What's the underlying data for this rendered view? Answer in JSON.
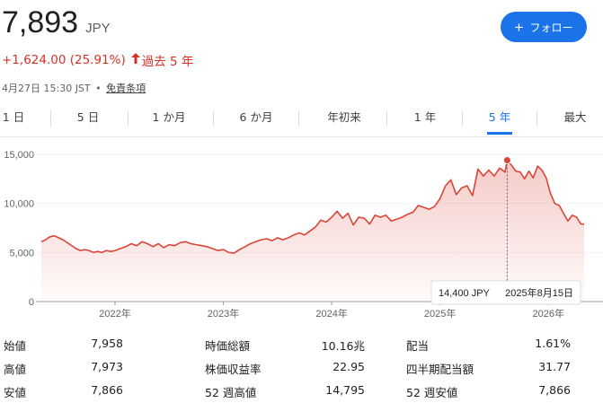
{
  "header": {
    "price": "7,893",
    "currency": "JPY",
    "change": "+1,624.00 (25.91%)",
    "change_period": "過去 5 年",
    "timestamp": "4月27日 15:30 JST",
    "separator": "•",
    "disclaimer": "免責条項",
    "follow_label": "フォロー",
    "follow_icon": "plus-icon",
    "accent_color": "#1a73e8",
    "negative_color": "#d93025"
  },
  "tabs": [
    {
      "label": "1 日",
      "active": false
    },
    {
      "label": "5 日",
      "active": false
    },
    {
      "label": "1 か月",
      "active": false
    },
    {
      "label": "6 か月",
      "active": false
    },
    {
      "label": "年初来",
      "active": false
    },
    {
      "label": "1 年",
      "active": false
    },
    {
      "label": "5 年",
      "active": true
    },
    {
      "label": "最大",
      "active": false
    }
  ],
  "chart_data": {
    "type": "area",
    "line_color": "#db4437",
    "y_ticks": [
      "15,000",
      "10,000",
      "5,000",
      "0"
    ],
    "y_tick_values": [
      15000,
      10000,
      5000,
      0
    ],
    "ylim": [
      0,
      15000
    ],
    "x_ticks": [
      "2022年",
      "2023年",
      "2024年",
      "2025年",
      "2026年"
    ],
    "x_tick_values": [
      2022.0,
      2023.0,
      2024.0,
      2025.0,
      2026.0
    ],
    "xlim": [
      2021.32,
      2026.33
    ],
    "grid": true,
    "tooltip": {
      "value": "14,400 JPY",
      "date": "2025年8月15日",
      "x": 2025.62,
      "y": 14400
    },
    "series": [
      {
        "x": [
          2021.32,
          2021.36,
          2021.4,
          2021.44,
          2021.48,
          2021.52,
          2021.56,
          2021.6,
          2021.64,
          2021.68,
          2021.72,
          2021.76,
          2021.8,
          2021.84,
          2021.88,
          2021.92,
          2021.96,
          2022.0,
          2022.05,
          2022.1,
          2022.15,
          2022.2,
          2022.25,
          2022.3,
          2022.35,
          2022.4,
          2022.45,
          2022.5,
          2022.55,
          2022.6,
          2022.65,
          2022.7,
          2022.75,
          2022.8,
          2022.85,
          2022.9,
          2022.95,
          2023.0,
          2023.05,
          2023.1,
          2023.15,
          2023.2,
          2023.25,
          2023.3,
          2023.35,
          2023.4,
          2023.45,
          2023.5,
          2023.55,
          2023.6,
          2023.65,
          2023.7,
          2023.75,
          2023.8,
          2023.85,
          2023.9,
          2023.95,
          2024.0,
          2024.05,
          2024.1,
          2024.15,
          2024.2,
          2024.25,
          2024.3,
          2024.35,
          2024.4,
          2024.45,
          2024.5,
          2024.55,
          2024.6,
          2024.65,
          2024.7,
          2024.75,
          2024.8,
          2024.85,
          2024.9,
          2024.95,
          2025.0,
          2025.05,
          2025.1,
          2025.15,
          2025.2,
          2025.25,
          2025.3,
          2025.35,
          2025.4,
          2025.45,
          2025.5,
          2025.55,
          2025.6,
          2025.62,
          2025.66,
          2025.7,
          2025.74,
          2025.78,
          2025.82,
          2025.86,
          2025.9,
          2025.94,
          2025.98,
          2026.02,
          2026.06,
          2026.1,
          2026.14,
          2026.18,
          2026.22,
          2026.26,
          2026.3,
          2026.33
        ],
        "y": [
          6100,
          6300,
          6600,
          6700,
          6500,
          6300,
          6000,
          5700,
          5400,
          5200,
          5300,
          5200,
          5000,
          5100,
          5000,
          5200,
          5100,
          5200,
          5400,
          5600,
          5900,
          5700,
          6100,
          5900,
          5600,
          5900,
          5500,
          5800,
          5700,
          6000,
          6100,
          5900,
          5800,
          5700,
          5600,
          5400,
          5200,
          5300,
          5000,
          4950,
          5300,
          5600,
          5900,
          6100,
          6300,
          6400,
          6200,
          6500,
          6300,
          6500,
          6800,
          7000,
          6800,
          7200,
          7600,
          8300,
          8100,
          8600,
          9200,
          8500,
          9000,
          7800,
          8600,
          8500,
          7900,
          8800,
          8600,
          8800,
          8200,
          8400,
          8600,
          8900,
          9100,
          9800,
          9600,
          9400,
          9700,
          10500,
          11800,
          12400,
          10900,
          11600,
          11800,
          10800,
          13500,
          12800,
          13400,
          12800,
          13600,
          13200,
          14400,
          13900,
          13300,
          13200,
          12500,
          13300,
          12600,
          13800,
          13400,
          12600,
          11000,
          10000,
          9800,
          9000,
          8200,
          8800,
          8600,
          7900,
          7893
        ]
      }
    ]
  },
  "stats": [
    [
      {
        "label": "始値",
        "value": "7,958"
      },
      {
        "label": "時価総額",
        "value": "10.16兆"
      },
      {
        "label": "配当",
        "value": "1.61%"
      }
    ],
    [
      {
        "label": "高値",
        "value": "7,973"
      },
      {
        "label": "株価収益率",
        "value": "22.95"
      },
      {
        "label": "四半期配当額",
        "value": "31.77"
      }
    ],
    [
      {
        "label": "安値",
        "value": "7,866"
      },
      {
        "label": "52 週高値",
        "value": "14,795"
      },
      {
        "label": "52 週安値",
        "value": "7,866"
      }
    ]
  ]
}
